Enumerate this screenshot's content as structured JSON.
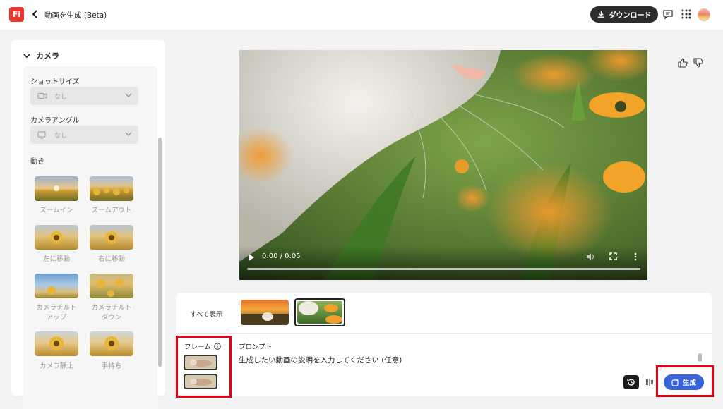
{
  "header": {
    "logo": "Fi",
    "title": "動画を生成 (Beta)",
    "download_label": "ダウンロード"
  },
  "left_panel": {
    "section_title": "カメラ",
    "shot_size_label": "ショットサイズ",
    "shot_size_value": "なし",
    "camera_angle_label": "カメラアングル",
    "camera_angle_value": "なし",
    "motion_label": "動き",
    "motions": [
      {
        "label": "ズームイン"
      },
      {
        "label": "ズームアウト"
      },
      {
        "label": "左に移動"
      },
      {
        "label": "右に移動"
      },
      {
        "label": "カメラチルト\nアップ"
      },
      {
        "label": "カメラチルト\nダウン"
      },
      {
        "label": "カメラ静止"
      },
      {
        "label": "手持ち"
      }
    ]
  },
  "video": {
    "time": "0:00 / 0:05",
    "progress": 0
  },
  "prompt_area": {
    "show_all": "すべて表示",
    "frame_label": "フレーム",
    "prompt_label": "プロンプト",
    "prompt_placeholder": "生成したい動画の説明を入力してください (任意)",
    "generate_label": "生成"
  },
  "colors": {
    "accent": "#3b63d8",
    "logo": "#e8372e",
    "highlight": "#e60012"
  }
}
